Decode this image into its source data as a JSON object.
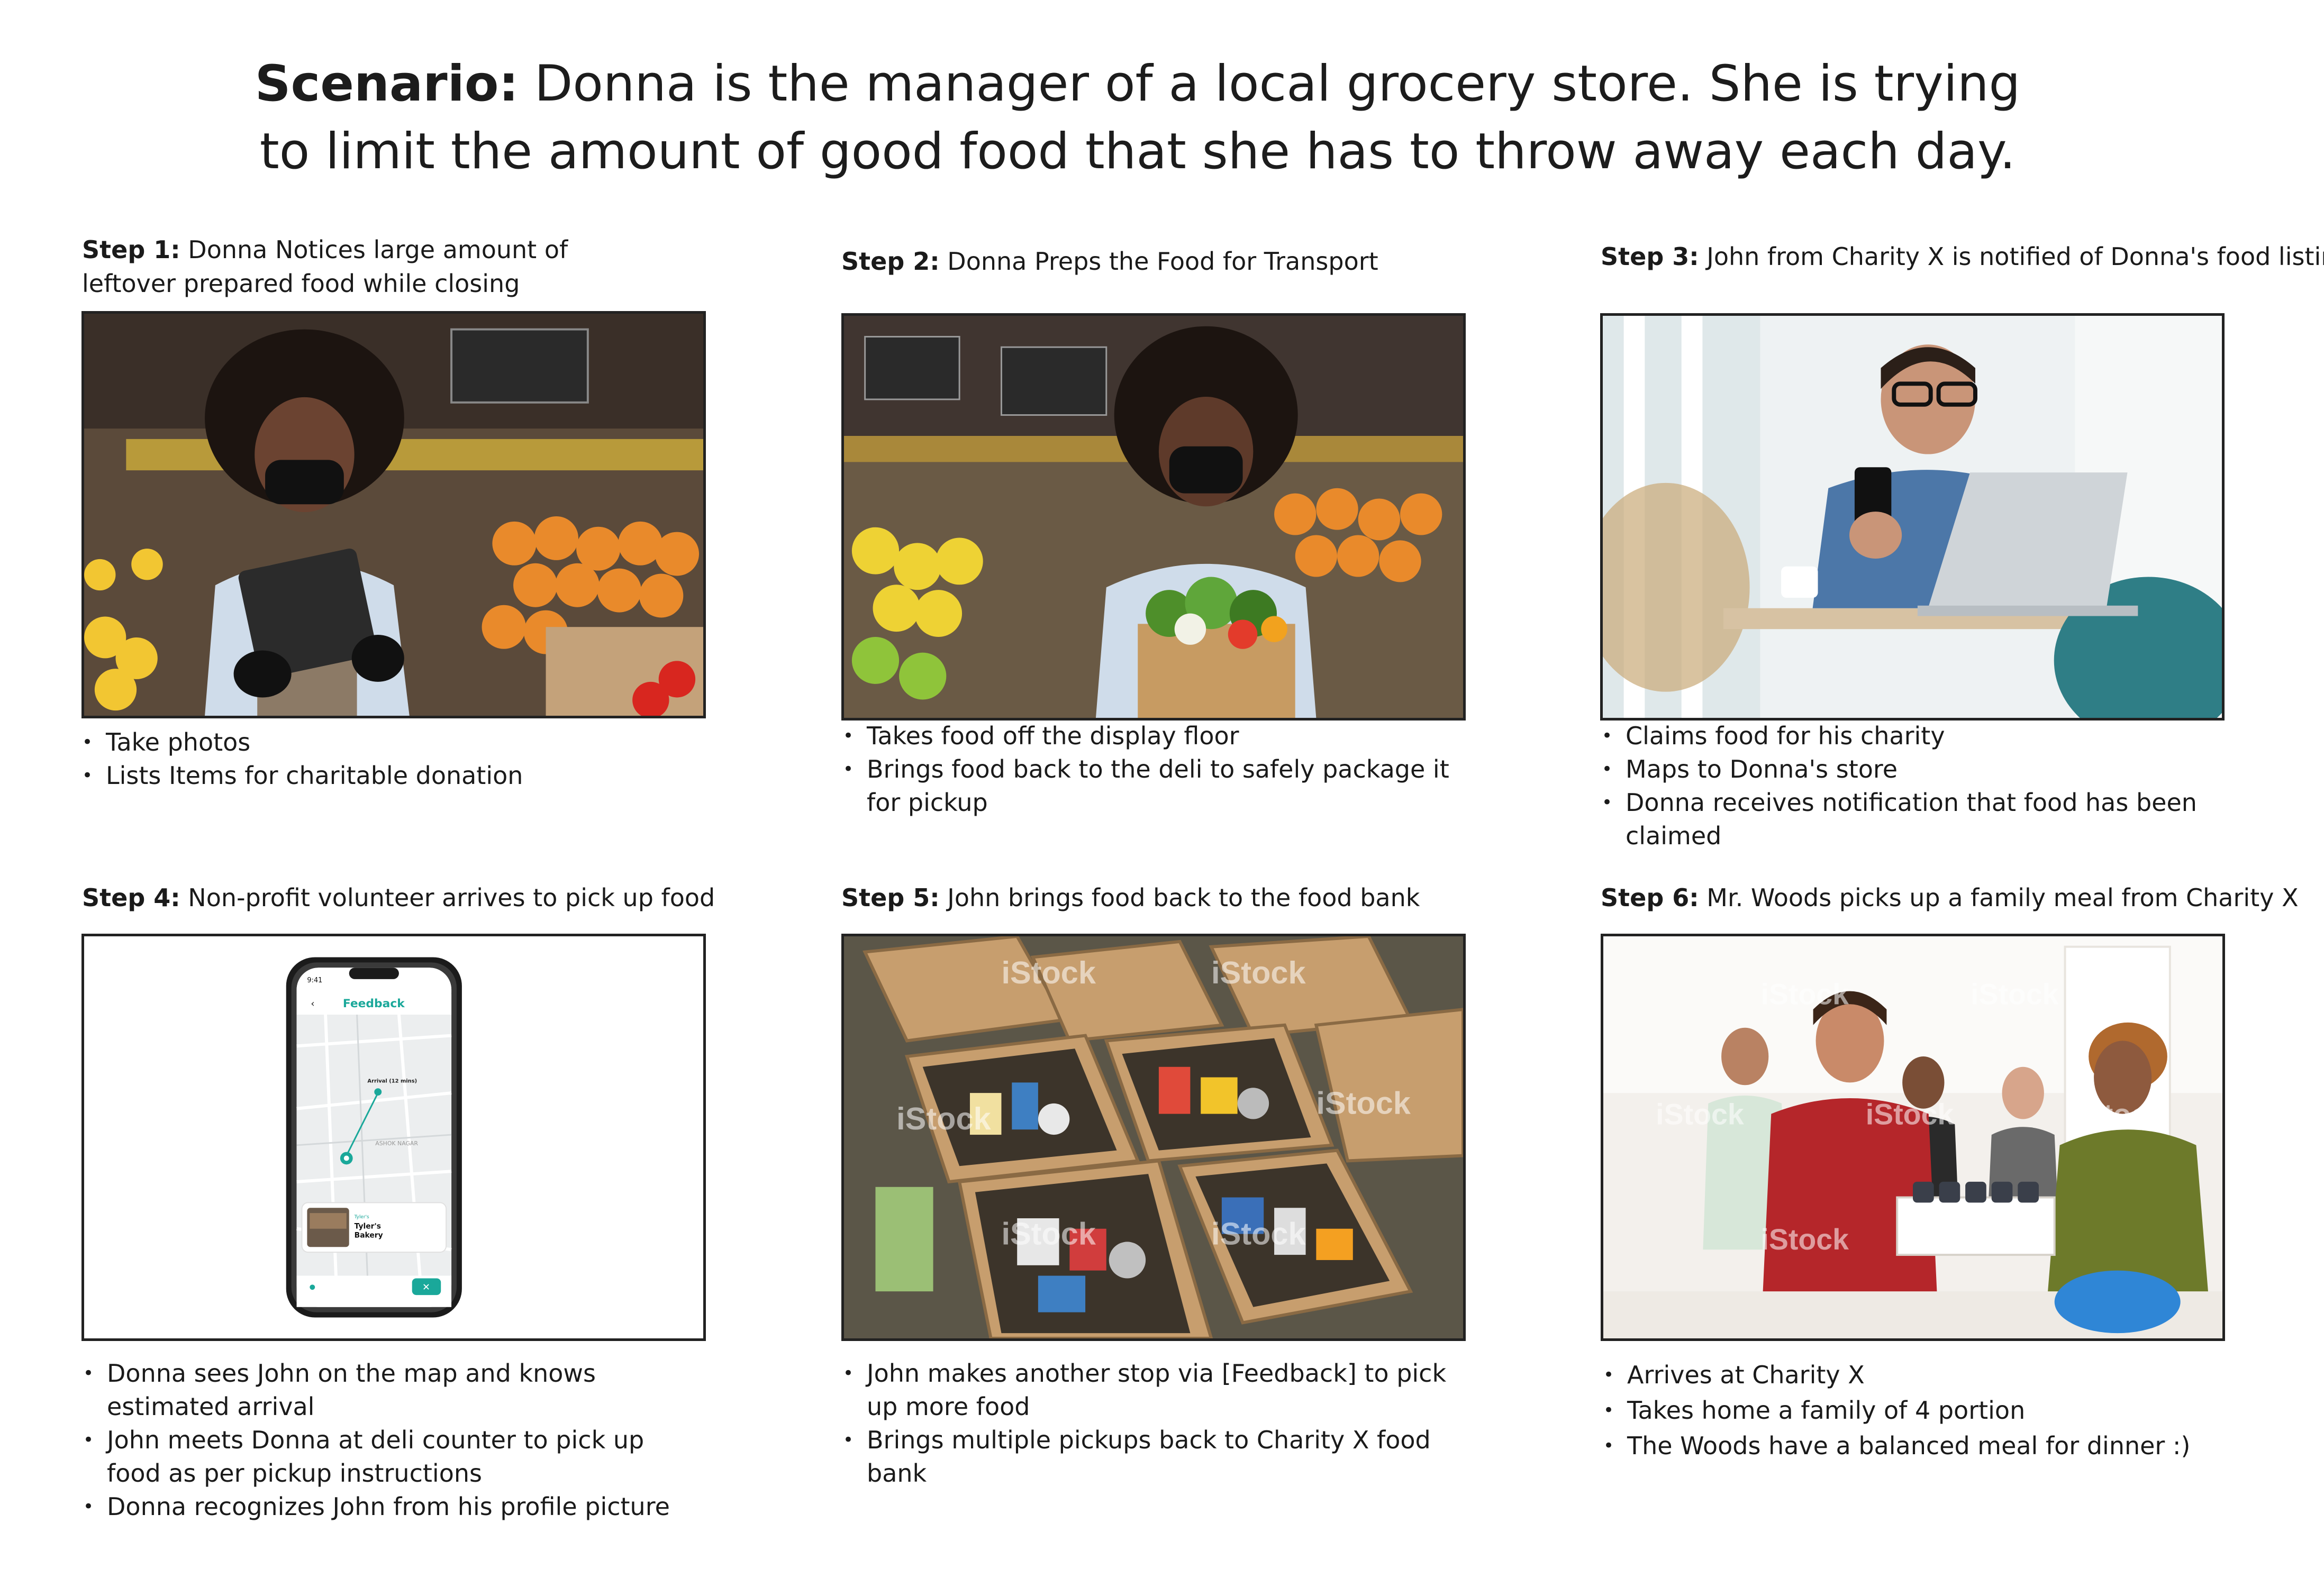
{
  "title": {
    "prefix": "Scenario:",
    "line1": " Donna is the manager of a local grocery store. She is trying",
    "line2": "to limit the amount of good food that she has to throw away each day."
  },
  "steps": [
    {
      "label": "Step 1:",
      "title": " Donna Notices large amount of leftover prepared food while closing",
      "bullets": [
        "Take photos",
        "Lists Items for charitable donation"
      ]
    },
    {
      "label": "Step 2:",
      "title": " Donna Preps the Food for Transport",
      "bullets": [
        "Takes food off the display floor",
        "Brings food back to the deli to safely package it for pickup"
      ]
    },
    {
      "label": "Step 3:",
      "title": " John from Charity X is notified of Donna's food listing",
      "bullets": [
        "Claims food for his charity",
        "Maps to Donna's store",
        "Donna receives notification that food has been claimed"
      ]
    },
    {
      "label": "Step 4:",
      "title": " Non-profit volunteer arrives to pick up food",
      "bullets": [
        "Donna sees John on the map and knows estimated arrival",
        "John meets Donna at deli counter to pick up food as per pickup instructions",
        "Donna recognizes John from his profile picture"
      ]
    },
    {
      "label": "Step 5:",
      "title": " John brings food back to the food bank",
      "bullets": [
        "John makes another stop via [Feedback] to pick up more food",
        "Brings multiple pickups back to Charity X food bank"
      ]
    },
    {
      "label": "Step 6:",
      "title": " Mr. Woods picks up a family meal from Charity X",
      "bullets": [
        "Arrives at Charity X",
        "Takes home a family of 4 portion",
        "The Woods have a balanced meal for dinner :)"
      ]
    }
  ],
  "phone": {
    "time": "9:41",
    "app_title": "Feedback",
    "arrival": "Arrival (12 mins)",
    "area": "ASHOK NAGAR",
    "card_tag": "Tyler's",
    "card_name1": "Tyler's",
    "card_name2": "Bakery"
  },
  "watermark": "iStock"
}
